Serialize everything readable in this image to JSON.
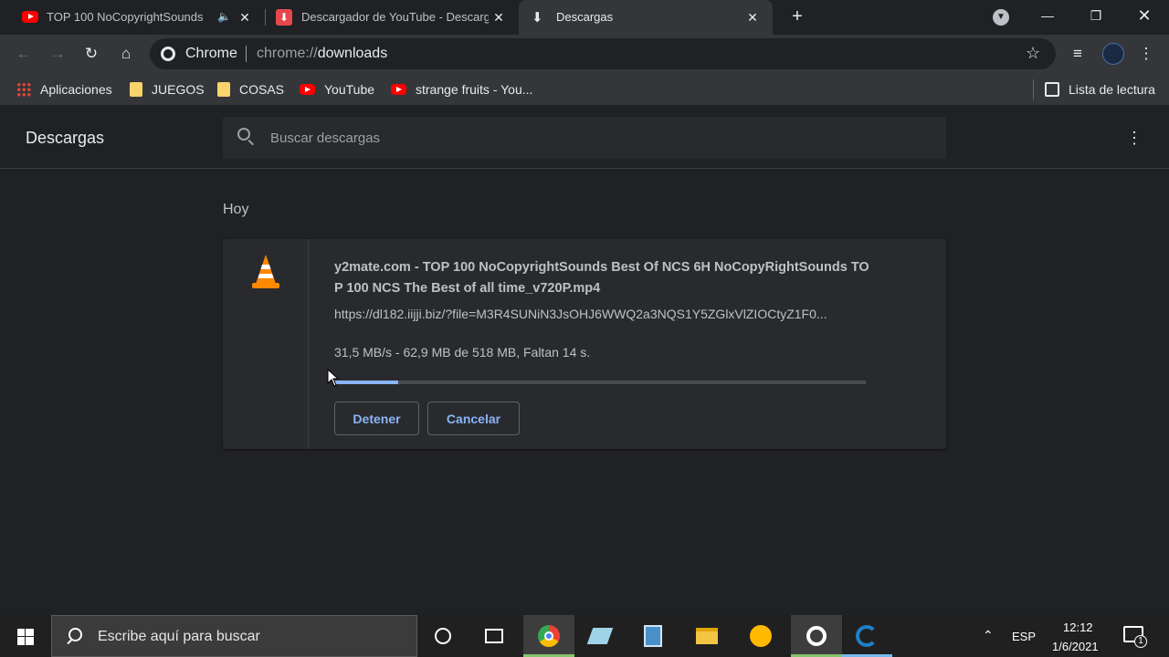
{
  "tabs": [
    {
      "title": "TOP 100 NoCopyrightSounds",
      "icon": "youtube-icon",
      "audio": true
    },
    {
      "title": "Descargador de YouTube - Descarg",
      "icon": "download-site-icon"
    },
    {
      "title": "Descargas",
      "icon": "download-icon",
      "active": true
    }
  ],
  "toolbar": {
    "site_label": "Chrome",
    "url_scheme": "chrome://",
    "url_path": "downloads"
  },
  "bookmarks": [
    {
      "label": "Aplicaciones",
      "icon": "apps-grid-icon"
    },
    {
      "label": "JUEGOS",
      "icon": "folder-icon"
    },
    {
      "label": "COSAS",
      "icon": "folder-icon"
    },
    {
      "label": "YouTube",
      "icon": "youtube-icon"
    },
    {
      "label": "strange fruits - You...",
      "icon": "youtube-icon"
    }
  ],
  "reading_list": "Lista de lectura",
  "downloads": {
    "title": "Descargas",
    "search_placeholder": "Buscar descargas",
    "day_label": "Hoy",
    "item": {
      "file_name": "y2mate.com - TOP 100 NoCopyrightSounds Best Of NCS 6H NoCopyRightSounds  TOP 100 NCS The Best of all time_v720P.mp4",
      "url": "https://dl182.iijji.biz/?file=M3R4SUNiN3JsOHJ6WWQ2a3NQS1Y5ZGlxVlZIOCtyZ1F0...",
      "status": "31,5 MB/s - 62,9 MB de 518 MB, Faltan 14 s.",
      "progress": 0.121,
      "pause_label": "Detener",
      "cancel_label": "Cancelar",
      "icon": "vlc-cone-icon"
    }
  },
  "taskbar": {
    "search_placeholder": "Escribe aquí para buscar",
    "language": "ESP",
    "time": "12:12",
    "date": "1/6/2021",
    "notifications": "1"
  }
}
